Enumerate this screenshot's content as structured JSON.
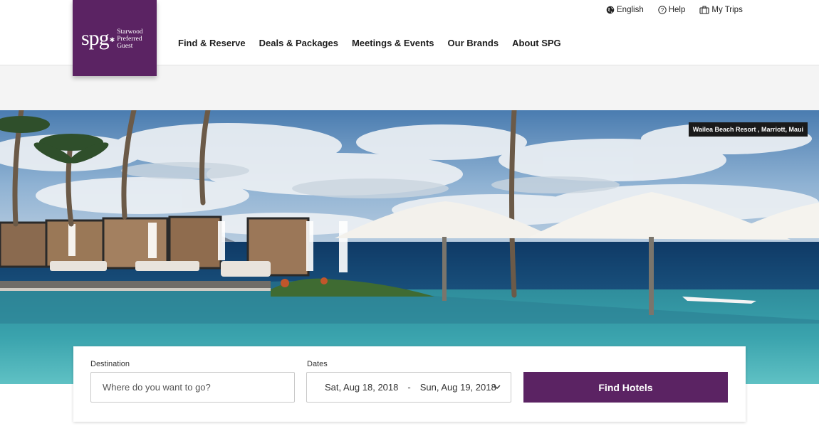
{
  "brand": {
    "logo_mark": "spg",
    "logo_words": [
      "Starwood",
      "Preferred",
      "Guest"
    ],
    "color": "#5b2363"
  },
  "utility_nav": [
    {
      "label": "English",
      "icon": "globe-icon"
    },
    {
      "label": "Help",
      "icon": "help-icon"
    },
    {
      "label": "My Trips",
      "icon": "suitcase-icon"
    }
  ],
  "main_nav": [
    {
      "label": "Find & Reserve"
    },
    {
      "label": "Deals & Packages"
    },
    {
      "label": "Meetings & Events"
    },
    {
      "label": "Our Brands"
    },
    {
      "label": "About SPG"
    }
  ],
  "hero": {
    "caption": "Wailea Beach Resort , Marriott, Maui"
  },
  "search": {
    "destination_label": "Destination",
    "destination_placeholder": "Where do you want to go?",
    "dates_label": "Dates",
    "check_in": "Sat, Aug 18, 2018",
    "date_separator": "-",
    "check_out": "Sun, Aug 19, 2018",
    "submit_label": "Find Hotels"
  }
}
